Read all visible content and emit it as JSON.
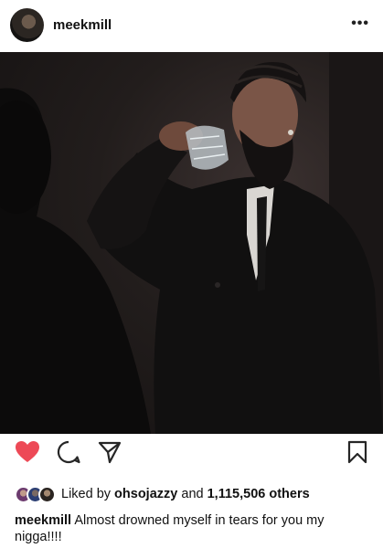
{
  "header": {
    "username": "meekmill",
    "more_label": "•••"
  },
  "post": {
    "image_description": "photo-man-drinking-from-glass-in-mirror"
  },
  "actions": {
    "like_color": "#ed4956",
    "liked": true
  },
  "likes": {
    "prefix": "Liked by",
    "first_user": "ohsojazzy",
    "connector": "and",
    "count": "1,115,506 others"
  },
  "caption": {
    "username": "meekmill",
    "text": "Almost drowned myself in tears for you my nigga!!!!"
  }
}
